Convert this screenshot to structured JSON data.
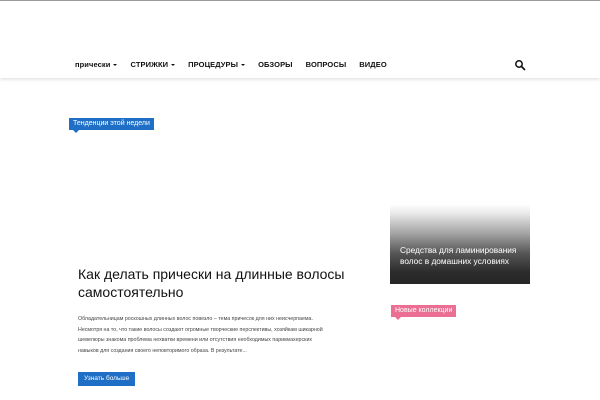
{
  "nav": {
    "items": [
      {
        "label": "прически",
        "has_dropdown": true
      },
      {
        "label": "СТРИЖКИ",
        "has_dropdown": true
      },
      {
        "label": "ПРОЦЕДУРЫ",
        "has_dropdown": true
      },
      {
        "label": "ОБЗОРЫ",
        "has_dropdown": false
      },
      {
        "label": "ВОПРОСЫ",
        "has_dropdown": false
      },
      {
        "label": "ВИДЕО",
        "has_dropdown": false
      }
    ],
    "search_icon": "search-icon"
  },
  "featured": {
    "category": "Тенденции этой недели",
    "title": "Как делать прически на длинные волосы самостоятельно",
    "excerpt": "Обладательницам роскошных длинных волос повезло – тема причесок для них неисчерпаема. Несмотря на то, что такие волосы создают огромные творческие перспективы, хозяйкам шикарной шевелюры знакома проблема нехватки времени или отсутствия необходимых парикмахерских навыков для создания своего неповторимого образа.        В результате...",
    "more_label": "Узнать больше"
  },
  "sidebar": {
    "card_title": "Средства для ламинирования волос в домашних условиях",
    "section_tag": "Новые коллекции"
  },
  "colors": {
    "accent_blue": "#1f6fc6",
    "accent_pink": "#ea6f93"
  }
}
